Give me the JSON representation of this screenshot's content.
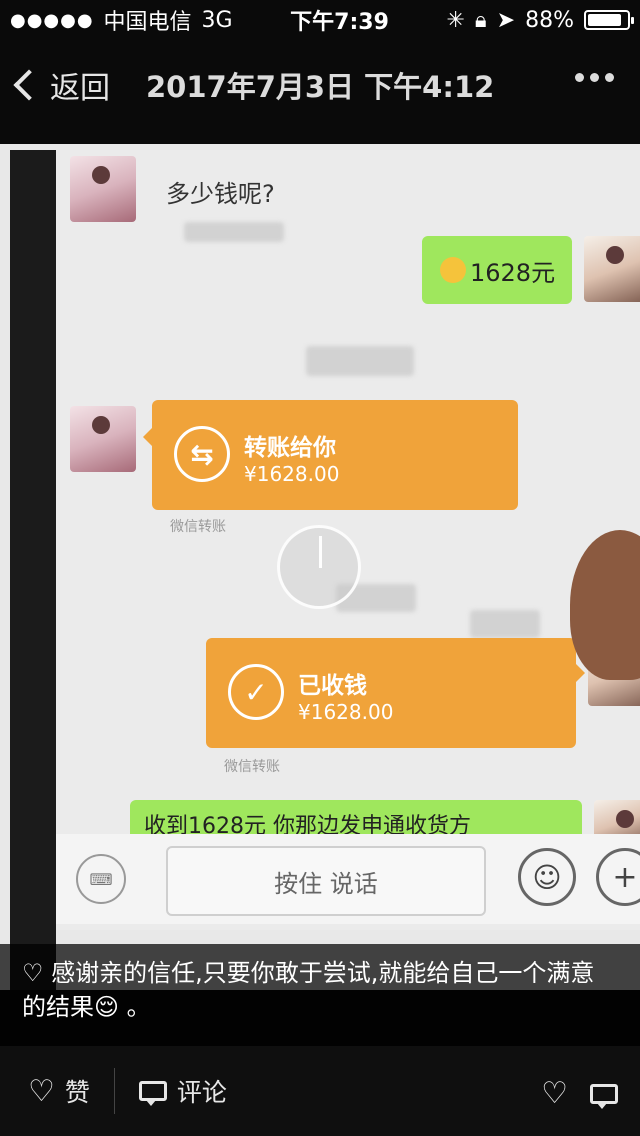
{
  "status_bar": {
    "signal": "●●●●●",
    "carrier": "中国电信",
    "network": "3G",
    "time": "下午7:39",
    "battery_percent": "88%",
    "battery_level": 0.88
  },
  "nav": {
    "back_label": "返回",
    "title": "2017年7月3日 下午4:12",
    "more_label": "•••"
  },
  "photo": {
    "incoming_text": "多少钱呢?",
    "outgoing_amount_text": "1628元",
    "transfer_card": {
      "title": "转账给你",
      "amount": "¥1628.00",
      "caption": "微信转账"
    },
    "received_card": {
      "title": "已收钱",
      "amount": "¥1628.00",
      "caption": "微信转账"
    },
    "partial_text": "收到1628元 你那边发申通收货方",
    "input_bar": {
      "talk_label": "按住 说话",
      "emoji_symbol": "☺",
      "plus_symbol": "+"
    }
  },
  "caption": {
    "text": "♡ 感谢亲的信任,只要你敢于尝试,就能给自己一个满意的结果😌 。"
  },
  "bottom_bar": {
    "like_label": "赞",
    "comment_label": "评论"
  },
  "colors": {
    "accent_orange": "#f0a33a",
    "bubble_green": "#9fe75d",
    "background_dark": "#0a0a0a"
  },
  "icons": [
    "back-chevron-icon",
    "more-icon",
    "heart-icon",
    "comment-icon",
    "keyboard-icon",
    "emoji-icon",
    "plus-icon",
    "transfer-icon",
    "check-icon",
    "play-spinner-icon"
  ]
}
